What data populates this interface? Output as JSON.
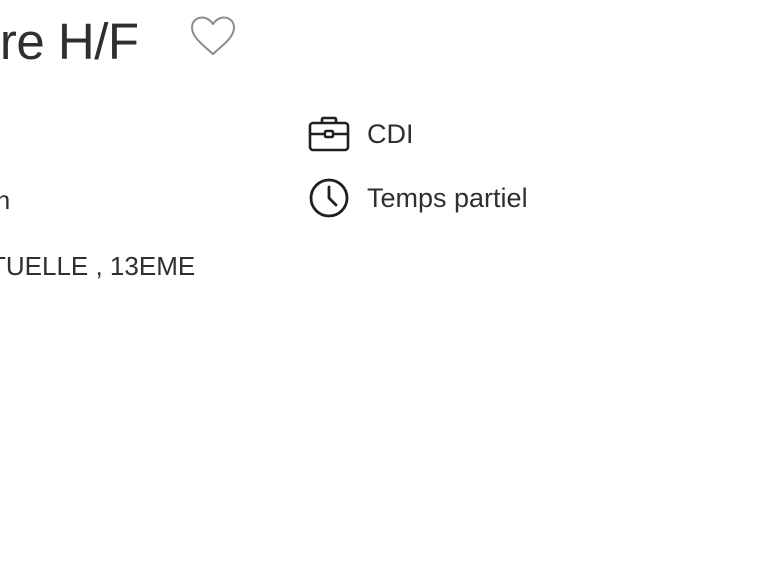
{
  "header": {
    "title": "ore H/F",
    "favorite_icon": "heart-outline-icon"
  },
  "details": {
    "left": {
      "line1": "in",
      "line2": "TUELLE , 13EME"
    },
    "contract": {
      "icon": "briefcase-icon",
      "label": "CDI"
    },
    "schedule": {
      "icon": "clock-icon",
      "label": "Temps partiel"
    }
  }
}
